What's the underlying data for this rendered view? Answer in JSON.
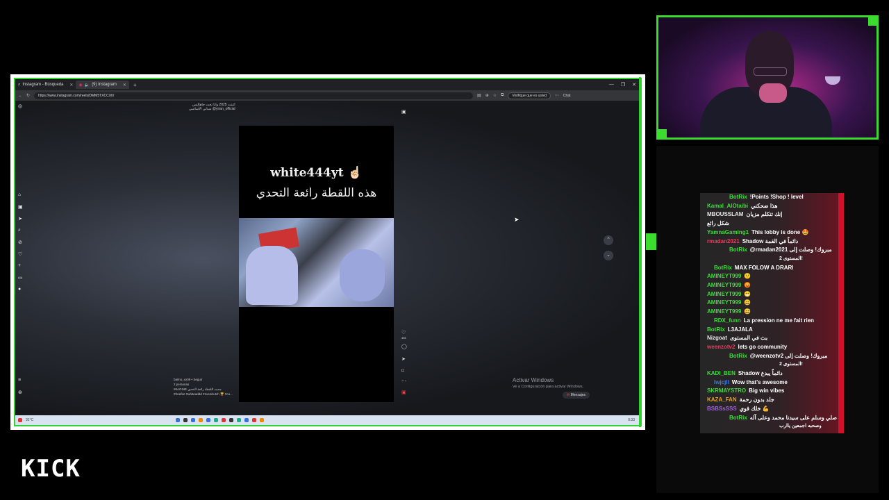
{
  "browser": {
    "tabs": [
      {
        "label": "Instagram - Búsqueda",
        "active": false
      },
      {
        "label": "(9) Instagram",
        "active": true
      }
    ],
    "new_tab": "+",
    "window_controls": [
      "—",
      "❐",
      "✕"
    ],
    "url": "https://www.instagram.com/reels/DMM5TXCCX0/",
    "verify_button": "Verifique que es usted",
    "chat_button": "Chat"
  },
  "reel": {
    "title": "white444yt ☝🏻",
    "arabic_caption": "هذه اللقطة رائعة التحدي",
    "top_caption_line1": "اثبتت 2025 وانا تحت جاهالنس",
    "top_caption_line2": "سبابي الأساسي @yrian_official",
    "author_name": "baimo_xx09 • Seguir",
    "author_sub": "2 personas",
    "author_caption": "IMAGINE محمد اللقطة رائعة التحدي",
    "author_tags": "#freefire #whiteaddd #1vs4clutch 🏆 #cu...",
    "like_count": "455"
  },
  "activate_windows": {
    "title": "Activar Windows",
    "subtitle": "Ve a Configuración para activar Windows."
  },
  "messages_pill": "Mensajes",
  "taskbar": {
    "weather": "31°C",
    "time": "0:33"
  },
  "chat": {
    "messages": [
      {
        "user": "BotRix",
        "color": "#3ddc3d",
        "text": "!Points !Shop ! level",
        "indent": 2
      },
      {
        "user": "Kamal_AlOtaibi",
        "color": "#3ddc3d",
        "text": "هذا ضحكني"
      },
      {
        "user": "MBOUSSLAM",
        "color": "#e8e8e8",
        "text": "إنك تتكلم مزيان"
      },
      {
        "user": "",
        "color": "#e03040",
        "text": "شكل رائع"
      },
      {
        "user": "YamnaGaming1",
        "color": "#3ddc3d",
        "text": "This lobby is done 🤩"
      },
      {
        "user": "rmadan2021",
        "color": "#e04060",
        "text": "Shadow دائماً في القمة"
      },
      {
        "user": "BotRix",
        "color": "#3ddc3d",
        "text": "@rmadan2021 مبروك! وصلت إلى",
        "cont": "المستوى 2!",
        "indent": 2
      },
      {
        "user": "BotRix",
        "color": "#3ddc3d",
        "text": "MAX FOLOW A DRARI",
        "indent": 1
      },
      {
        "user": "AMINEYT999",
        "color": "#3ddc3d",
        "text": "🙂"
      },
      {
        "user": "AMINEYT999",
        "color": "#3ddc3d",
        "text": "😡"
      },
      {
        "user": "AMINEYT999",
        "color": "#3ddc3d",
        "text": "😁"
      },
      {
        "user": "AMINEYT999",
        "color": "#3ddc3d",
        "text": "😄"
      },
      {
        "user": "AMINEYT999",
        "color": "#3ddc3d",
        "text": "😅"
      },
      {
        "user": "RDX_funn",
        "color": "#3ddc3d",
        "text": "La pression ne me fait rien",
        "indent": 1
      },
      {
        "user": "BotRix",
        "color": "#3ddc3d",
        "text": "L3AJALA"
      },
      {
        "user": "Nizgoat",
        "color": "#e8e8e8",
        "text": "بث في المستوى"
      },
      {
        "user": "weenzotv2",
        "color": "#e04060",
        "text": "lets go community"
      },
      {
        "user": "BotRix",
        "color": "#3ddc3d",
        "text": "@weenzotv2 مبروك! وصلت إلى",
        "cont": "المستوى 2!",
        "indent": 2
      },
      {
        "user": "KADI_BEN",
        "color": "#3ddc3d",
        "text": "Shadow دائماً يبدع"
      },
      {
        "user": "Iwjcjll",
        "color": "#3a7ae0",
        "text": "Wow that's awesome",
        "indent": 1
      },
      {
        "user": "SKRMAYSTRO",
        "color": "#3ddc3d",
        "text": "Big win vibes"
      },
      {
        "user": "KAZA_FAN",
        "color": "#e8a020",
        "text": "جلد بدون رحمة"
      },
      {
        "user": "BSBSsSSS",
        "color": "#a060e0",
        "text": "خلك قوي 💪"
      },
      {
        "user": "BotRix",
        "color": "#3ddc3d",
        "text": "اللهم صلي وسلم على سيدنا محمد وعلى آله",
        "cont": "وصحبه اجمعين ياارب",
        "indent": 2
      }
    ]
  },
  "brand": {
    "logo": "KICK",
    "accent": "#3bdc2f",
    "chat_accent": "#d01028"
  }
}
